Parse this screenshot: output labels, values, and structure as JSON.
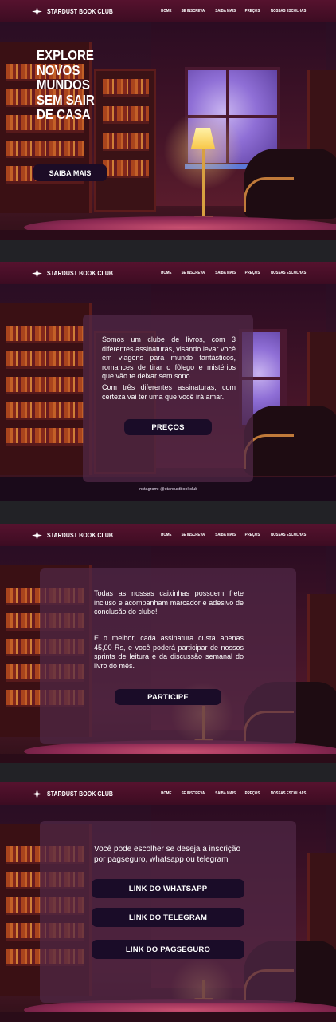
{
  "header": {
    "brand": "STARDUST BOOK CLUB",
    "brand_icon": "sparkle-star-icon",
    "nav": [
      "HOME",
      "SE INSCREVA",
      "SAIBA MAIS",
      "PREÇOS",
      "NOSSAS ESCOLHAS"
    ]
  },
  "section1": {
    "title": "EXPLORE NOVOS MUNDOS SEM SAIR DE CASA",
    "button": "SAIBA MAIS"
  },
  "section2": {
    "paragraph1": "Somos um clube de livros, com 3 diferentes assinaturas, visando levar você em viagens para mundo fantásticos, romances de tirar o fôlego e mistérios que vão te deixar sem sono.",
    "paragraph2": "Com três diferentes assinaturas, com certeza vai ter uma que você irá amar.",
    "button": "PREÇOS",
    "instagram": "Instagram: @stardustbookclub"
  },
  "section3": {
    "paragraph1": "Todas as nossas caixinhas possuem frete incluso e acompanham marcador e adesivo de conclusão do clube!",
    "paragraph2": "E o melhor, cada assinatura custa apenas 45,00 Rs, e você poderá participar de nossos sprints de leitura e da discussão semanal do livro do mês.",
    "button": "PARTICIPE"
  },
  "section4": {
    "intro": "Você pode escolher se deseja a inscrição por pagseguro, whatsapp ou telegram",
    "buttons": [
      "LINK DO WHATSAPP",
      "LINK DO TELEGRAM",
      "LINK DO PAGSEGURO"
    ]
  },
  "colors": {
    "header": "#4a0f28",
    "button": "#1a0c28",
    "panel": "#50284699",
    "gap": "#222226"
  }
}
